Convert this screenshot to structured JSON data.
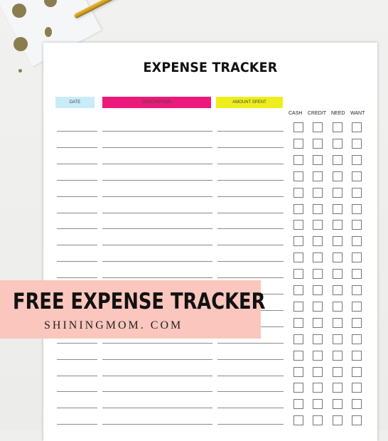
{
  "sheet": {
    "title": "EXPENSE TRACKER",
    "columns": [
      {
        "label": "DATE",
        "color": "#c9ecf8"
      },
      {
        "label": "DESCRIPTION",
        "color": "#ec1a7a"
      },
      {
        "label": "AMOUNT SPENT",
        "color": "#eeee1e"
      }
    ],
    "checkbox_columns": [
      "CASH",
      "CREDIT",
      "NEED",
      "WANT"
    ],
    "row_count": 19
  },
  "banner": {
    "title": "FREE EXPENSE TRACKER",
    "subtitle": "SHININGMOM. COM",
    "color": "#fbc6bd"
  },
  "decor": {
    "dot_color": "#8a7d4e",
    "pen_color": "#d4a62a"
  }
}
